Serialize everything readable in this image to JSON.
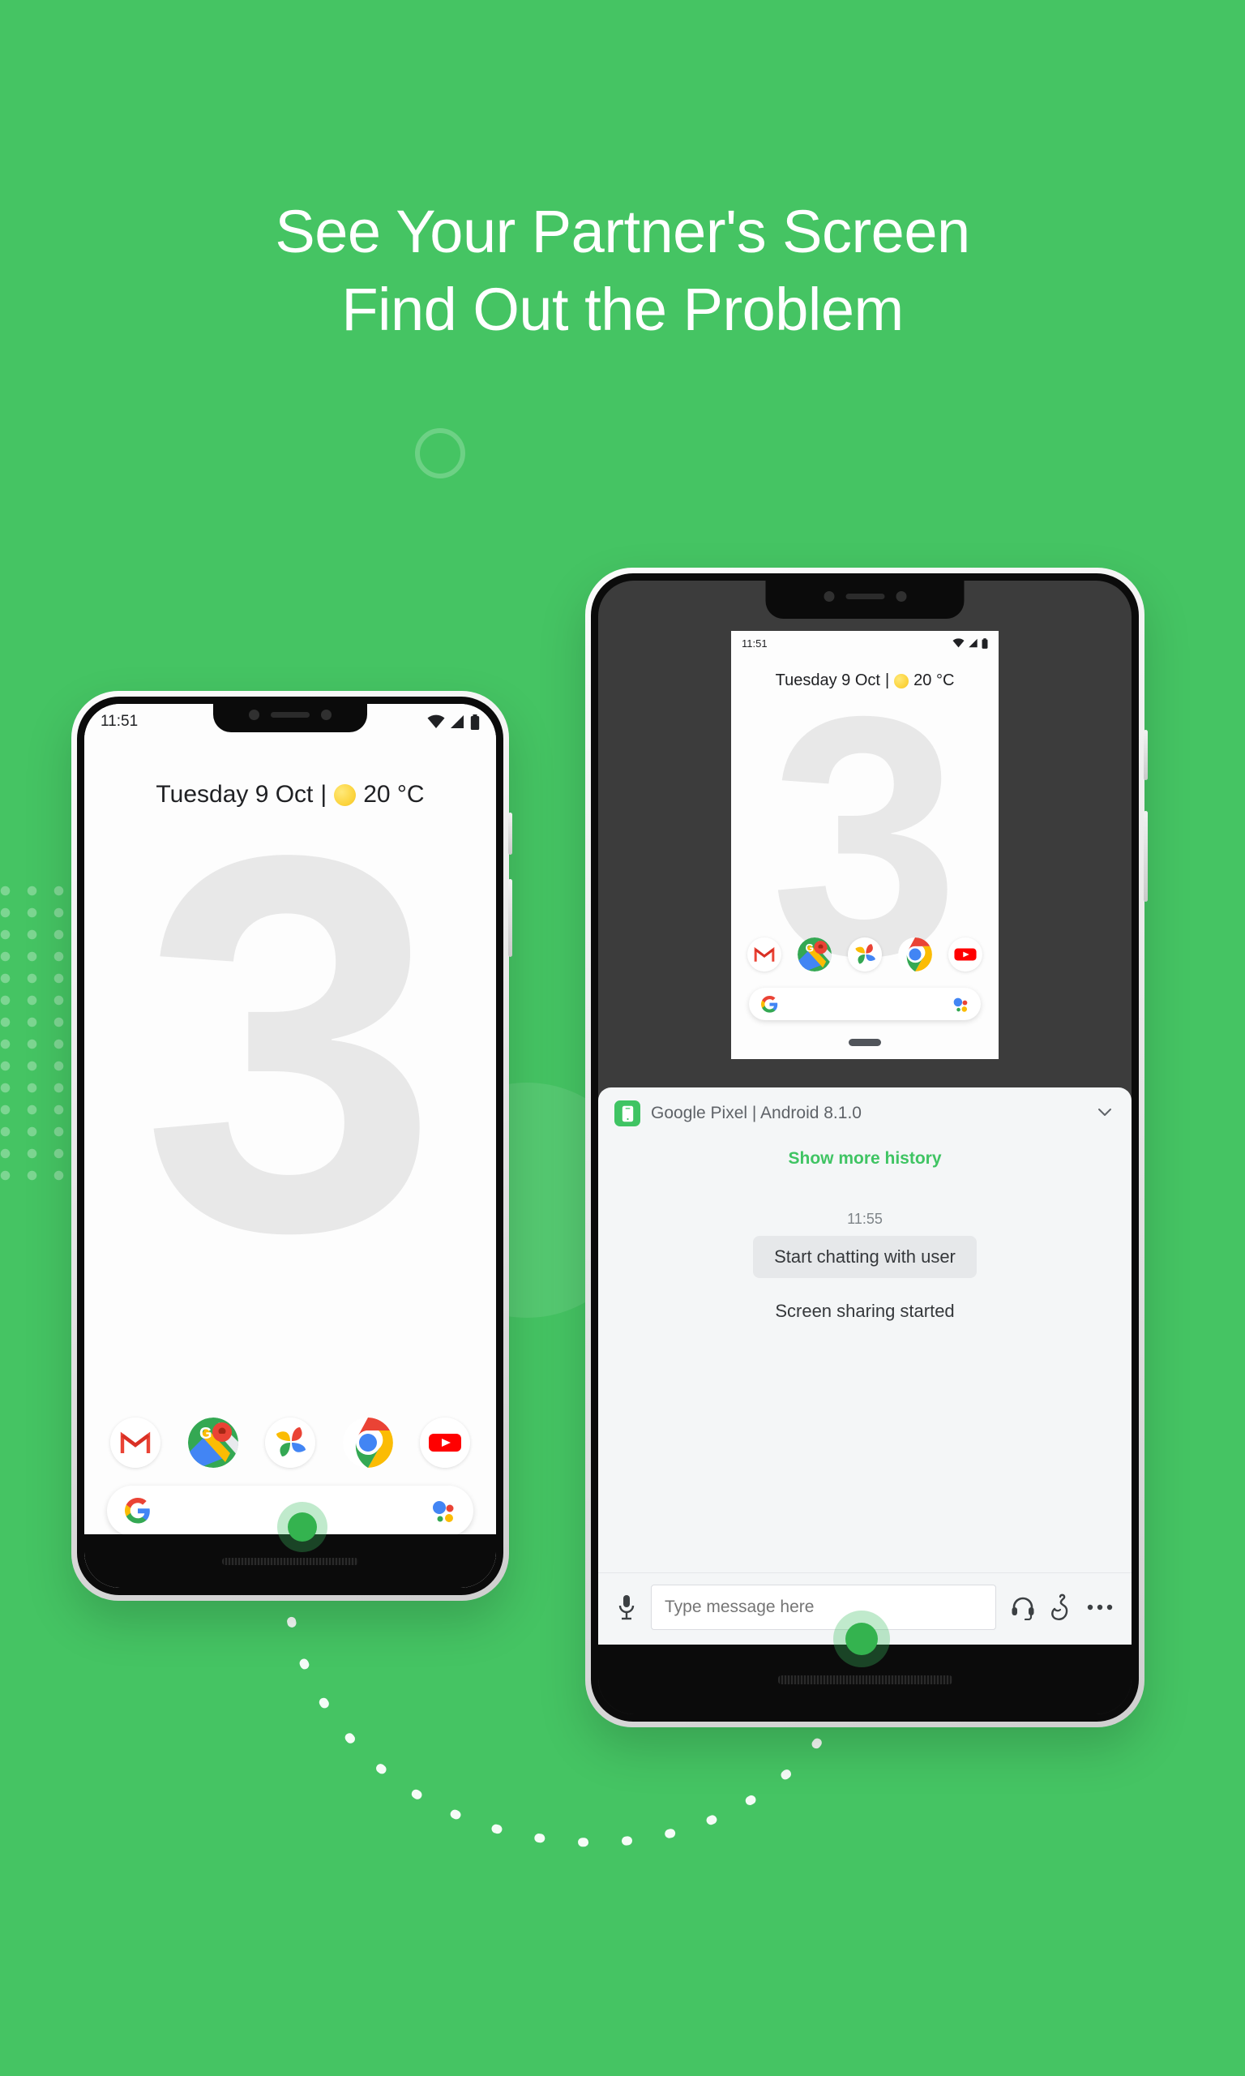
{
  "page": {
    "headline_line1": "See Your Partner's Screen",
    "headline_line2": "Find Out the Problem",
    "background_color": "#45c463",
    "accent_color": "#3fc463"
  },
  "phone_left": {
    "status": {
      "time": "11:51",
      "wifi_icon": "wifi-icon",
      "signal_icon": "signal-icon",
      "battery_icon": "battery-icon"
    },
    "weather": {
      "date": "Tuesday 9 Oct",
      "separator": "|",
      "condition_icon": "sun-icon",
      "temperature": "20 °C"
    },
    "wallpaper_text": "3",
    "dock": [
      {
        "name": "gmail-icon",
        "label": "Gmail"
      },
      {
        "name": "maps-icon",
        "label": "Maps"
      },
      {
        "name": "photos-icon",
        "label": "Photos"
      },
      {
        "name": "chrome-icon",
        "label": "Chrome"
      },
      {
        "name": "youtube-icon",
        "label": "YouTube"
      }
    ],
    "search": {
      "google_icon": "google-g-icon",
      "assistant_icon": "google-assistant-icon"
    }
  },
  "phone_right": {
    "mirror": {
      "status": {
        "time": "11:51",
        "wifi_icon": "wifi-icon",
        "signal_icon": "signal-icon",
        "battery_icon": "battery-icon"
      },
      "weather": {
        "date": "Tuesday 9 Oct",
        "separator": "|",
        "condition_icon": "sun-icon",
        "temperature": "20 °C"
      },
      "wallpaper_text": "3",
      "dock": [
        {
          "name": "gmail-icon",
          "label": "Gmail"
        },
        {
          "name": "maps-icon",
          "label": "Maps"
        },
        {
          "name": "photos-icon",
          "label": "Photos"
        },
        {
          "name": "chrome-icon",
          "label": "Chrome"
        },
        {
          "name": "youtube-icon",
          "label": "YouTube"
        }
      ],
      "search": {
        "google_icon": "google-g-icon",
        "assistant_icon": "google-assistant-icon"
      }
    },
    "chat": {
      "device_label": "Google Pixel | Android 8.1.0",
      "device_icon": "phone-device-icon",
      "collapse_icon": "chevron-down-icon",
      "show_more_history": "Show more history",
      "timestamp": "11:55",
      "bubble_text": "Start chatting with user",
      "status_message": "Screen sharing started",
      "input_placeholder": "Type message here",
      "input_value": "",
      "mic_icon": "microphone-icon",
      "headset_icon": "headset-icon",
      "gesture_icon": "hand-gesture-icon",
      "more_icon": "more-options-icon"
    }
  }
}
